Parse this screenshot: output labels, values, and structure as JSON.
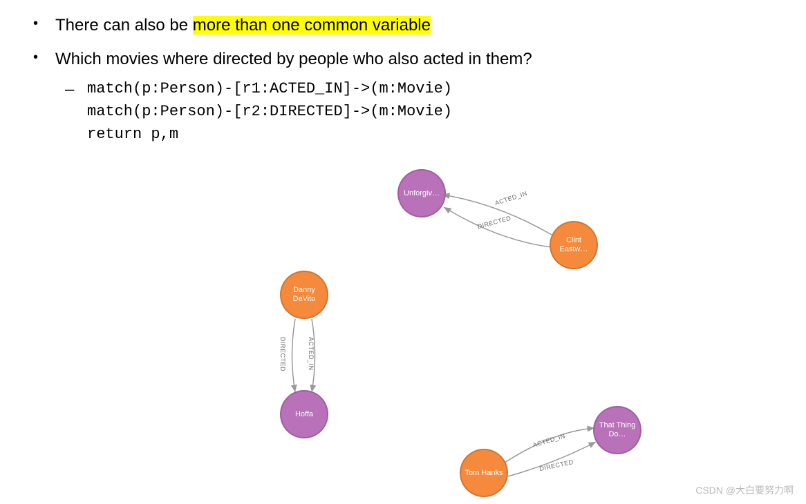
{
  "bullets": {
    "b1_pre": "There can also be ",
    "b1_hl": "more than one common variable",
    "b2": "Which movies where directed by people who also acted in them?"
  },
  "code": {
    "line1": "match(p:Person)-[r1:ACTED_IN]->(m:Movie)",
    "line2": "match(p:Person)-[r2:DIRECTED]->(m:Movie)",
    "line3": "return p,m"
  },
  "graph": {
    "nodes": {
      "unforgiven": "Unforgiv…",
      "clint": "Clint Eastw…",
      "danny": "Danny DeVito",
      "hoffa": "Hoffa",
      "tom": "Tom Hanks",
      "thatthing": "That Thing Do…"
    },
    "edge_labels": {
      "acted_in": "ACTED_IN",
      "directed": "DIRECTED"
    }
  },
  "watermark": "CSDN @大白要努力啊"
}
